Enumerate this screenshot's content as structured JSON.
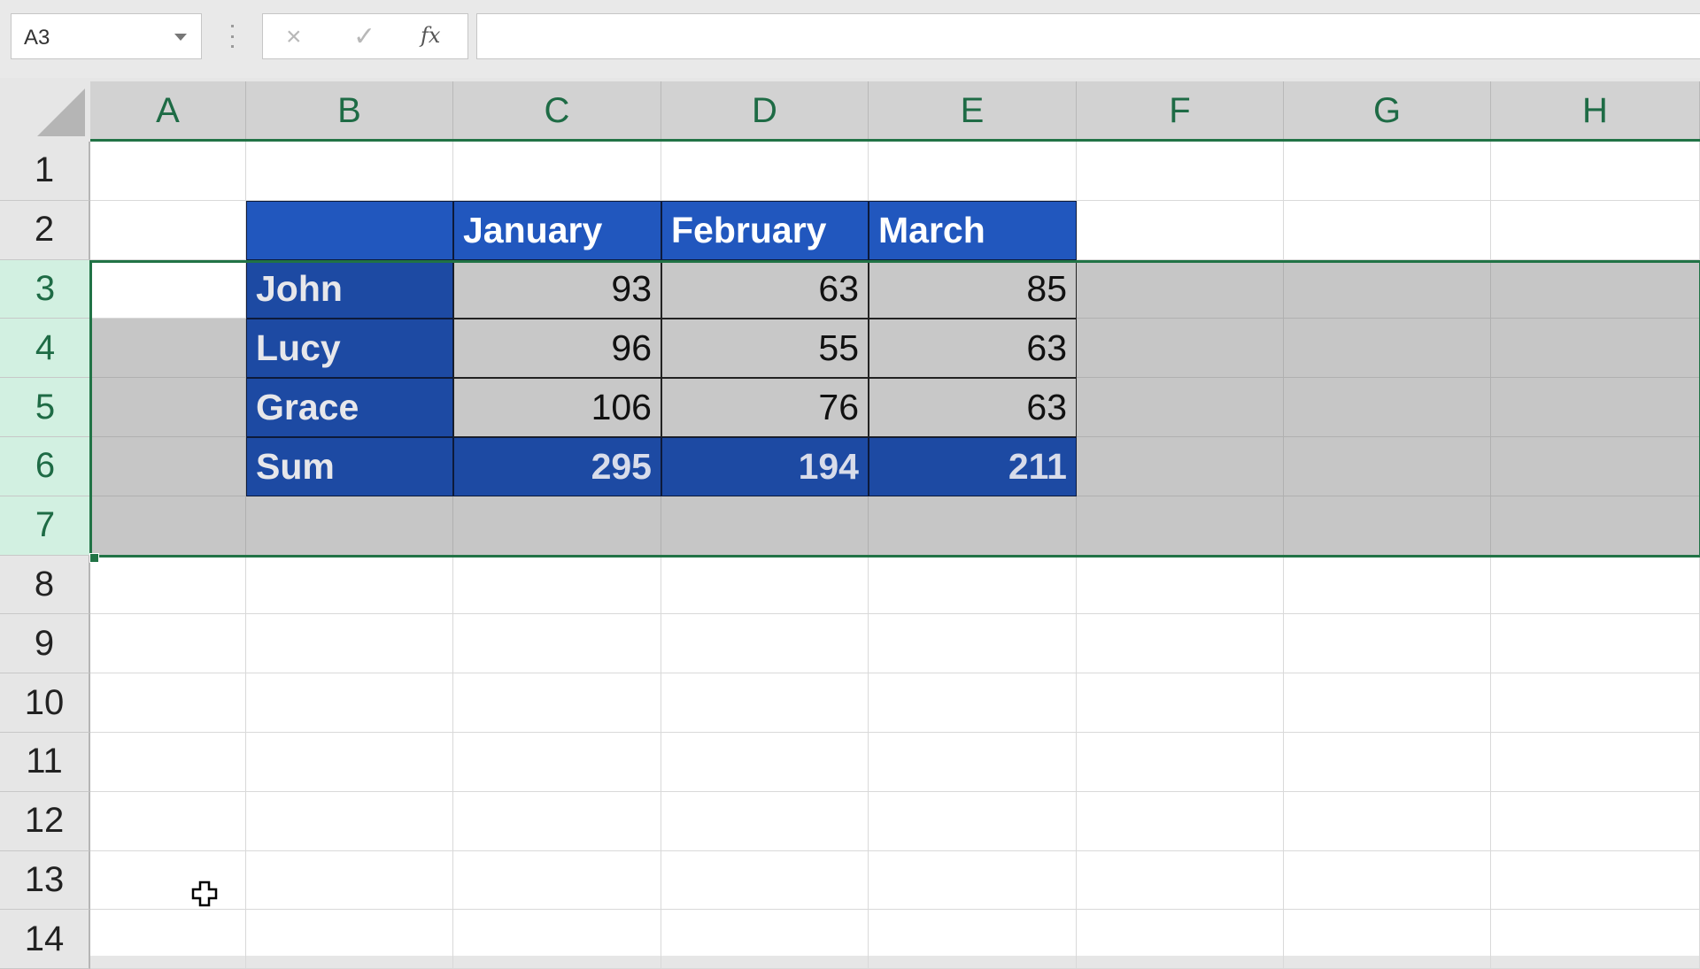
{
  "formula_bar": {
    "name_box_value": "A3",
    "cancel_icon": "×",
    "enter_icon": "✓",
    "fx_label": "fx",
    "formula_value": ""
  },
  "columns": [
    "A",
    "B",
    "C",
    "D",
    "E",
    "F",
    "G",
    "H"
  ],
  "rows": [
    "1",
    "2",
    "3",
    "4",
    "5",
    "6",
    "7",
    "8",
    "9",
    "10",
    "11",
    "12",
    "13",
    "14"
  ],
  "selected_rows": [
    "3",
    "4",
    "5",
    "6",
    "7"
  ],
  "table": {
    "headers": [
      "",
      "January",
      "February",
      "March"
    ],
    "body": [
      {
        "name": "John",
        "values": [
          "93",
          "63",
          "85"
        ]
      },
      {
        "name": "Lucy",
        "values": [
          "96",
          "55",
          "63"
        ]
      },
      {
        "name": "Grace",
        "values": [
          "106",
          "76",
          "63"
        ]
      }
    ],
    "sum": {
      "name": "Sum",
      "values": [
        "295",
        "194",
        "211"
      ]
    }
  },
  "colors": {
    "accent_green": "#217346",
    "header_blue": "#2157be",
    "name_blue": "#1d4aa3",
    "selection_gray": "#c6c6c6"
  }
}
